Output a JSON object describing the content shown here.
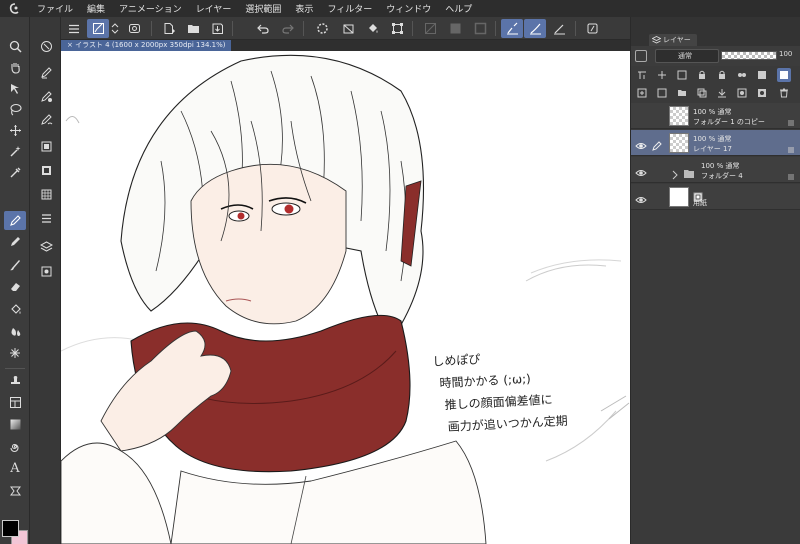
{
  "menu": {
    "items": [
      "ファイル",
      "編集",
      "アニメーション",
      "レイヤー",
      "選択範囲",
      "表示",
      "フィルター",
      "ウィンドウ",
      "ヘルプ"
    ]
  },
  "canvas_tab": {
    "title": "イラスト 4 (1600 x 2000px 350dpi 134.1%)"
  },
  "layer_panel": {
    "tab_label": "レイヤー",
    "blend_mode": "通常",
    "opacity": "100",
    "layers": [
      {
        "opacity_mode": "100 % 通常",
        "name": "フォルダー 1 のコピー",
        "type": "layer",
        "selected": false
      },
      {
        "opacity_mode": "100 % 通常",
        "name": "レイヤー 17",
        "type": "layer",
        "selected": true
      },
      {
        "opacity_mode": "100 % 通常",
        "name": "フォルダー 4",
        "type": "folder",
        "selected": false
      },
      {
        "opacity_mode": "",
        "name": "用紙",
        "type": "paper",
        "selected": false
      }
    ]
  },
  "canvas_note": {
    "lines": [
      "しめぽぴ",
      "時間かかる (;ω;)",
      "推しの顔面偏差値に",
      "画力が追いつかん定期"
    ]
  },
  "colors": {
    "accent": "#5b74a9",
    "scarf": "#8a2e2b",
    "main_color": "#000000",
    "sub_color": "#f2c6d6"
  }
}
